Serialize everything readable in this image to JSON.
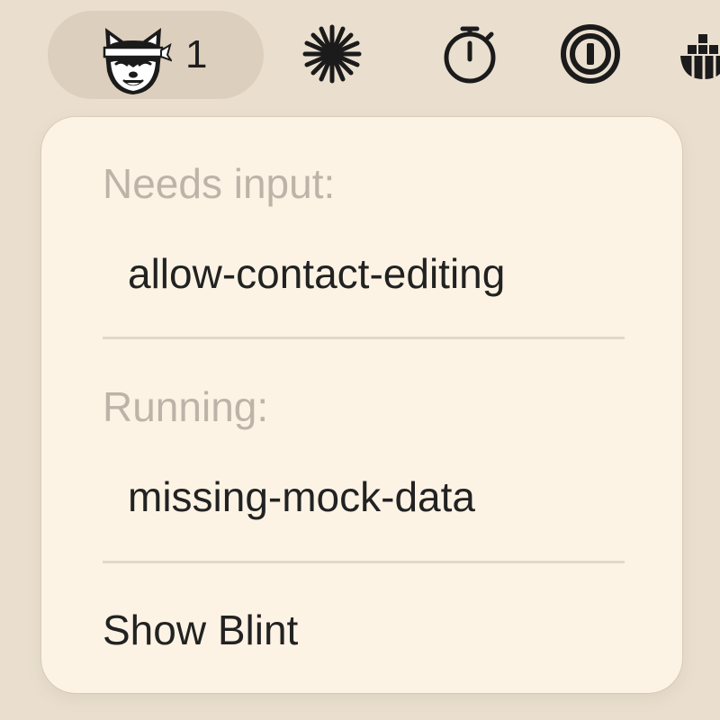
{
  "menubar": {
    "app_badge_count": "1",
    "icons": [
      "blint-fox-icon",
      "starburst-icon",
      "stopwatch-icon",
      "password-manager-icon",
      "container-icon"
    ]
  },
  "menu": {
    "needs_input_header": "Needs input:",
    "needs_input_item": "allow-contact-editing",
    "running_header": "Running:",
    "running_item": "missing-mock-data",
    "show_app": "Show Blint"
  },
  "colors": {
    "background": "#eadfcf",
    "pill": "#dccfbd",
    "menu_bg": "#fcf3e4",
    "header_text": "#bdb4a9",
    "item_text": "#222222"
  }
}
